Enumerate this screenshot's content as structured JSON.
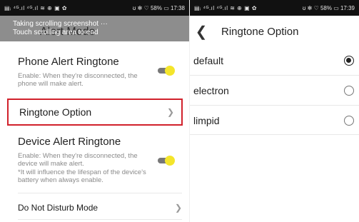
{
  "status_bar": {
    "left_icons_text": "▤ᵢ ⁴ᴳ.ıl ⁴ᴳ.ıl ≋ ⊕ ▣ ✿",
    "right_text": "ʊ ✻ ♡ 58% ▭ 17:38",
    "right_text_alt": "ʊ ✻ ♡ 58% ▭ 17:39"
  },
  "left": {
    "banner": {
      "ghost_title": "Alert Mode",
      "line1": "Taking scrolling screenshot ···",
      "line2": "Touch scrolling area to end"
    },
    "phone_alert": {
      "title": "Phone Alert Ringtone",
      "desc": "Enable: When they're disconnected, the phone will make alert.",
      "toggle_on": true
    },
    "ringtone_option": {
      "label": "Ringtone Option",
      "chevron": "chevron-right-icon"
    },
    "device_alert": {
      "title": "Device Alert Ringtone",
      "desc_line1": "Enable: When they're disconnected, the device will make alert.",
      "desc_line2": "*It will influence the lifespan of the device's battery when always enable.",
      "toggle_on": true
    },
    "do_not_disturb": {
      "label": "Do Not Disturb Mode",
      "chevron": "chevron-right-icon"
    },
    "colors": {
      "toggle_knob": "#f4e52b",
      "highlight_border": "#d1212b"
    }
  },
  "right": {
    "header": {
      "title": "Ringtone Option",
      "back_icon": "back-arrow-icon"
    },
    "options": [
      {
        "label": "default",
        "selected": true
      },
      {
        "label": "electron",
        "selected": false
      },
      {
        "label": "limpid",
        "selected": false
      }
    ]
  }
}
